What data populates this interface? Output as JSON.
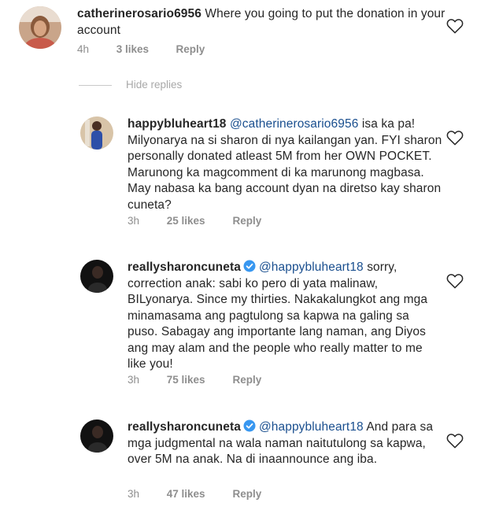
{
  "comments": [
    {
      "username": "catherinerosario6956",
      "text": "Where you going to put the donation in your account",
      "time": "4h",
      "likes": "3 likes",
      "reply": "Reply"
    }
  ],
  "hide_replies": "Hide replies",
  "replies": [
    {
      "username": "happybluheart18",
      "mention": "@catherinerosario6956",
      "text_line1_rest": " isa ka",
      "text_rest": "pa! Milyonarya na si sharon di nya kailangan yan. FYI sharon personally donated atleast 5M from her OWN POCKET. Marunong ka magcomment di ka marunong magbasa. May nabasa ka bang account dyan na diretso kay sharon cuneta?",
      "time": "3h",
      "likes": "25 likes",
      "reply": "Reply"
    },
    {
      "username": "reallysharoncuneta",
      "mention": "@happybluheart18",
      "text_line1_rest": " sorry,",
      "text_rest": "correction anak: sabi ko pero di yata malinaw, BILyonarya. Since my thirties. Nakakalungkot ang mga minamasama ang pagtulong sa kapwa na galing sa puso. Sabagay ang importante lang naman, ang Diyos ang may alam and the people who really matter to me like you!",
      "time": "3h",
      "likes": "75 likes",
      "reply": "Reply"
    },
    {
      "username": "reallysharoncuneta",
      "mention": "@happybluheart18",
      "text_line1_rest": " And para",
      "text_rest": "sa mga judgmental na wala naman naitutulong sa kapwa, over 5M na anak. Na di inaannounce ang iba.",
      "time": "3h",
      "likes": "47 likes",
      "reply": "Reply"
    }
  ],
  "colors": {
    "text": "#262626",
    "meta": "#8e8e8e",
    "mention": "#1a4f8f",
    "verified": "#3897f0"
  }
}
